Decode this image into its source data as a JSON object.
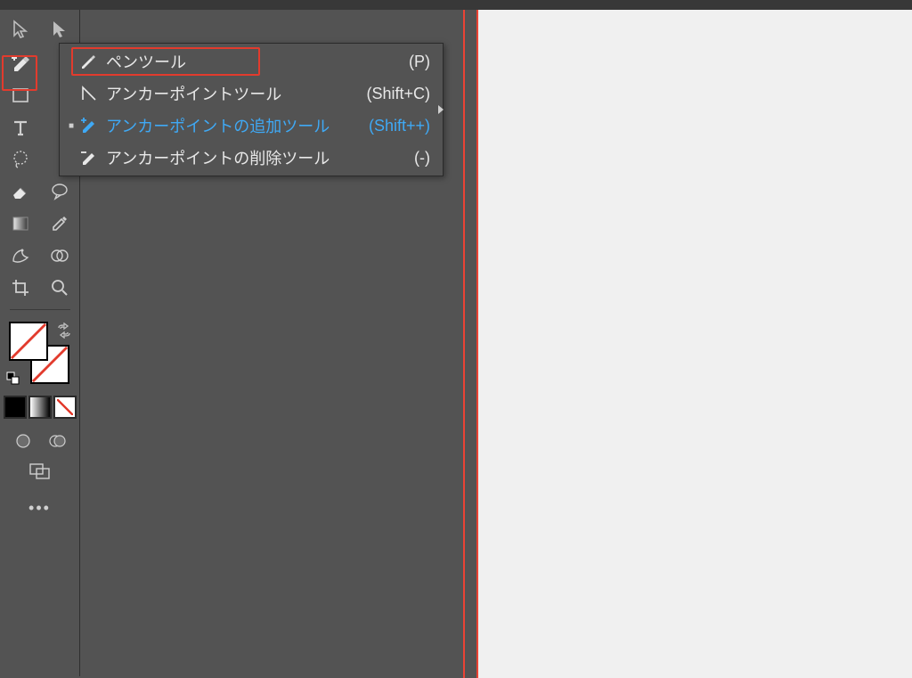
{
  "flyout": {
    "items": [
      {
        "label": "ペンツール",
        "shortcut": "(P)",
        "icon": "pen-icon"
      },
      {
        "label": "アンカーポイントツール",
        "shortcut": "(Shift+C)",
        "icon": "angle-icon"
      },
      {
        "label": "アンカーポイントの追加ツール",
        "shortcut": "(Shift++)",
        "icon": "pen-plus-icon"
      },
      {
        "label": "アンカーポイントの削除ツール",
        "shortcut": "(-)",
        "icon": "pen-minus-icon"
      }
    ],
    "active_index": 2
  },
  "toolbox": {
    "row1": {
      "left": "selection-tool-icon",
      "right": "direct-selection-tool-icon"
    },
    "row2": {
      "left": "add-anchor-pen-icon",
      "right": ""
    },
    "row3": {
      "left": "rectangle-tool-icon",
      "right": ""
    },
    "row4": {
      "left": "type-tool-icon",
      "right": ""
    },
    "row5": {
      "left": "lasso-tool-icon",
      "right": ""
    },
    "row6": {
      "left": "eraser-tool-icon",
      "right": "speech-balloon-tool-icon"
    },
    "row7": {
      "left": "gradient-tool-icon",
      "right": "eyedropper-tool-icon"
    },
    "row8": {
      "left": "perspective-warp-tool-icon",
      "right": "shape-builder-tool-icon"
    },
    "row9": {
      "left": "crop-tool-icon",
      "right": "zoom-tool-icon"
    }
  },
  "colors": {
    "highlight_red": "#ea4335",
    "active_blue": "#3fa9f5",
    "panel_bg": "#535353",
    "canvas_bg": "#f0f0f0"
  }
}
